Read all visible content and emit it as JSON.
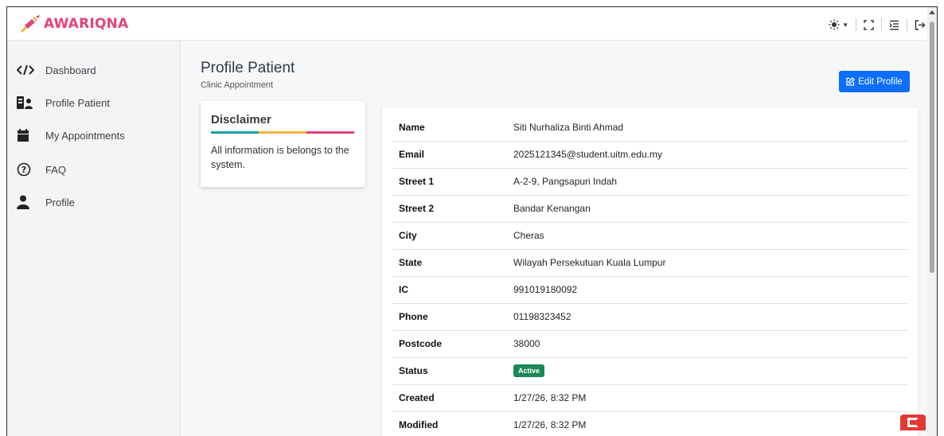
{
  "brand": {
    "name": "AWARIQNA",
    "color": "#e2437c"
  },
  "sidebar": {
    "items": [
      {
        "label": "Dashboard",
        "icon": "code-icon"
      },
      {
        "label": "Profile Patient",
        "icon": "id-card-icon"
      },
      {
        "label": "My Appointments",
        "icon": "calendar-icon"
      },
      {
        "label": "FAQ",
        "icon": "question-circle-icon"
      },
      {
        "label": "Profile",
        "icon": "user-icon"
      }
    ]
  },
  "header": {
    "title": "Profile Patient",
    "subtitle": "Clinic Appointment",
    "edit_label": "Edit Profile"
  },
  "disclaimer": {
    "title": "Disclaimer",
    "text": "All information is belongs to the system.",
    "bar_colors": [
      "#1aa3a3",
      "#f2b33d",
      "#e2437c"
    ]
  },
  "profile": {
    "rows": [
      {
        "key": "Name",
        "value": "Siti Nurhaliza Binti Ahmad"
      },
      {
        "key": "Email",
        "value": "2025121345@student.uitm.edu.my"
      },
      {
        "key": "Street 1",
        "value": "A-2-9, Pangsapuri Indah"
      },
      {
        "key": "Street 2",
        "value": "Bandar Kenangan"
      },
      {
        "key": "City",
        "value": "Cheras"
      },
      {
        "key": "State",
        "value": "Wilayah Persekutuan Kuala Lumpur"
      },
      {
        "key": "IC",
        "value": "991019180092"
      },
      {
        "key": "Phone",
        "value": "01198323452"
      },
      {
        "key": "Postcode",
        "value": "38000"
      },
      {
        "key": "Status",
        "value": "Active",
        "badge_color": "#198754"
      },
      {
        "key": "Created",
        "value": "1/27/26, 8:32 PM"
      },
      {
        "key": "Modified",
        "value": "1/27/26, 8:32 PM"
      }
    ]
  },
  "accent": "#0d6efd"
}
